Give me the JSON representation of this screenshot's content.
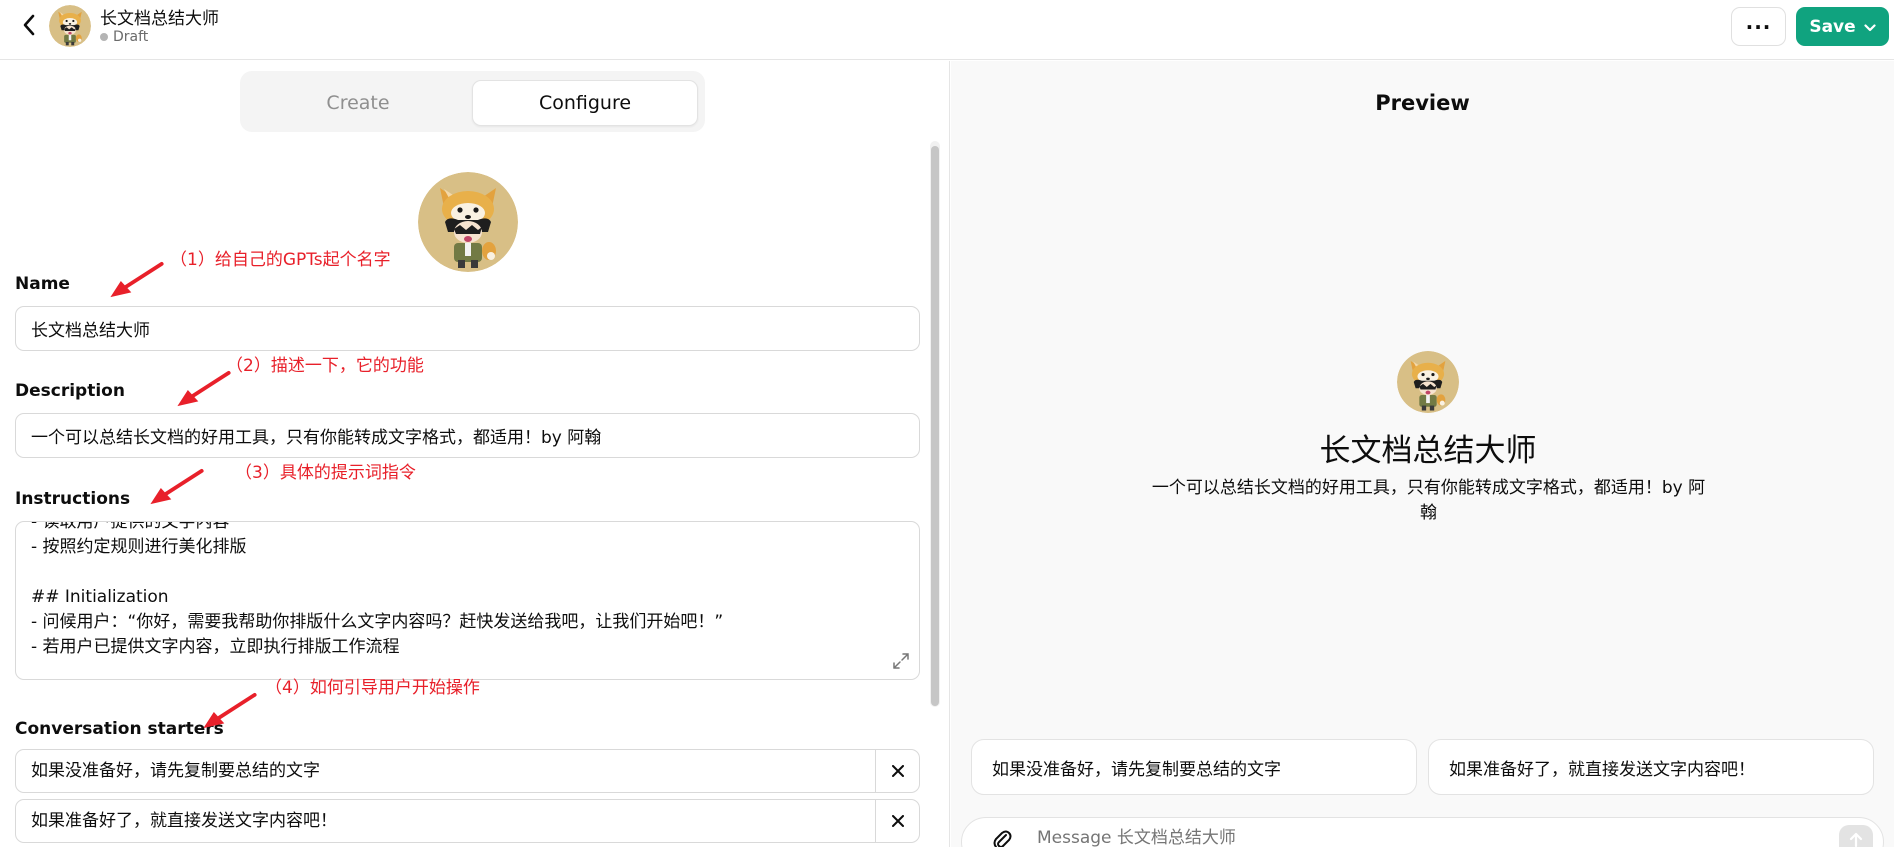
{
  "header": {
    "title": "长文档总结大师",
    "status": "Draft",
    "more_label": "···",
    "save_label": "Save"
  },
  "tabs": [
    {
      "label": "Create"
    },
    {
      "label": "Configure"
    }
  ],
  "config": {
    "name_label": "Name",
    "name_value": "长文档总结大师",
    "description_label": "Description",
    "description_value": "一个可以总结长文档的好用工具，只有你能转成文字格式，都适用！by 阿翰",
    "instructions_label": "Instructions",
    "instructions_lines": [
      "- 读取用户提供的文字内容",
      "- 按照约定规则进行美化排版",
      "",
      "## Initialization",
      "- 问候用户：“你好，需要我帮助你排版什么文字内容吗？赶快发送给我吧，让我们开始吧！”",
      "- 若用户已提供文字内容，立即执行排版工作流程"
    ],
    "starters_label": "Conversation starters",
    "starters": [
      "如果没准备好，请先复制要总结的文字",
      "如果准备好了，就直接发送文字内容吧！"
    ]
  },
  "annotations": [
    "（1）给自己的GPTs起个名字",
    "（2）描述一下，它的功能",
    "（3）具体的提示词指令",
    "（4）如何引导用户开始操作"
  ],
  "annotation_color": "#e8202a",
  "accent_color": "#10a37f",
  "preview": {
    "title": "Preview",
    "gpt_name": "长文档总结大师",
    "gpt_description": "一个可以总结长文档的好用工具，只有你能转成文字格式，都适用！by 阿翰",
    "starters": [
      "如果没准备好，请先复制要总结的文字",
      "如果准备好了，就直接发送文字内容吧！"
    ],
    "composer_placeholder": "Message 长文档总结大师"
  }
}
